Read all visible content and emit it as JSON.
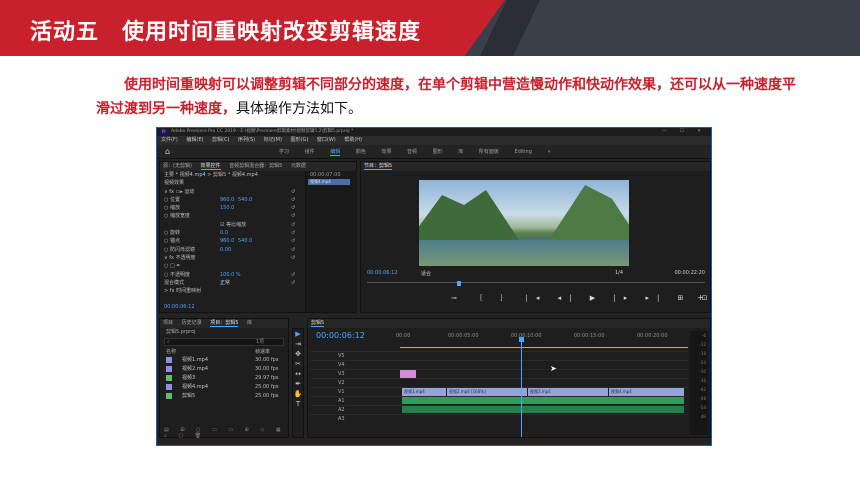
{
  "banner": {
    "title": "活动五　使用时间重映射改变剪辑速度"
  },
  "intro": {
    "red": "使用时间重映射可以调整剪辑不同部分的速度，在单个剪辑中营造慢动作和快动作效果，还可以从一种速度平滑过渡到另一种速度，",
    "black": "具体操作方法如下。"
  },
  "app": {
    "title": "Adobe Premiere Pro CC 2019 - E:\\视频\\Premiere剪辑素材\\视频剪辑5.2\\剪辑5.prproj *",
    "logo": "Pr",
    "window_buttons": "— ☐ ✕",
    "menu": [
      "文件(F)",
      "编辑(E)",
      "剪辑(C)",
      "序列(S)",
      "标记(M)",
      "图形(G)",
      "窗口(W)",
      "帮助(H)"
    ],
    "workspaces": [
      "学习",
      "组件",
      "编辑",
      "颜色",
      "效果",
      "音频",
      "图形",
      "库",
      "所有面板",
      "Editing"
    ],
    "active_workspace": "编辑"
  },
  "effect_controls": {
    "tabs": [
      "源：(无剪辑)",
      "效果控件",
      "音频剪辑混合器：剪辑5",
      "元数据"
    ],
    "clip_path": "主要 * 视频4.mp4  >  剪辑5 * 视频4.mp4",
    "rows": [
      {
        "label": "视频效果",
        "v": "",
        "v2": ""
      },
      {
        "label": "∨ fx ▭▸ 运动",
        "v": "",
        "v2": ""
      },
      {
        "label": "  ○ 位置",
        "v": "960.0",
        "v2": "540.0"
      },
      {
        "label": "  ○ 缩放",
        "v": "150.0",
        "v2": ""
      },
      {
        "label": "  ○ 缩放宽度",
        "v": "",
        "v2": ""
      },
      {
        "label": "",
        "v": "☑ 等比缩放",
        "v2": ""
      },
      {
        "label": "  ○ 旋转",
        "v": "0.0",
        "v2": ""
      },
      {
        "label": "  ○ 锚点",
        "v": "960.0",
        "v2": "540.0"
      },
      {
        "label": "  ○ 防闪烁滤镜",
        "v": "0.00",
        "v2": ""
      },
      {
        "label": "∨ fx 不透明度",
        "v": "",
        "v2": ""
      },
      {
        "label": "  ○ □ ✒",
        "v": "",
        "v2": ""
      },
      {
        "label": "  ○ 不透明度",
        "v": "100.0 %",
        "v2": ""
      },
      {
        "label": "    混合模式",
        "v": "正常",
        "v2": ""
      },
      {
        "label": "> fx 时间重映射",
        "v": "",
        "v2": ""
      }
    ],
    "timecode": "00:00:06:12",
    "tl_time": "00:00:07:00",
    "clip_name": "视频4.mp4"
  },
  "program_monitor": {
    "tab": "节目：剪辑5",
    "timecode": "00:00:06:12",
    "fit": "适合",
    "ratio": "1/4",
    "duration": "00:00:22:20",
    "controls": "⊸ ｛ ｝ |◂ ◂| ▶ |▸ ▸| ⊞ ⊡ ◫ ⊕",
    "plus": "+"
  },
  "project": {
    "tabs": [
      "项目",
      "历史记录",
      "项目：剪辑5",
      "库"
    ],
    "name": "剪辑5.prproj",
    "search_placeholder": "⌕",
    "count": "1项",
    "col_name": "名称",
    "col_rate": "帧速率",
    "items": [
      {
        "name": "视频1.mp4",
        "rate": "30.00 fps"
      },
      {
        "name": "视频2.mp4",
        "rate": "30.00 fps"
      },
      {
        "name": "视频3",
        "rate": "29.97 fps"
      },
      {
        "name": "视频4.mp4",
        "rate": "25.00 fps"
      },
      {
        "name": "剪辑5",
        "rate": "25.00 fps"
      }
    ],
    "bottombar": "▤ ⊞ ○ ▭ ▭ ⊕ ◇ ▦ ⌕ ▢ 🗑"
  },
  "tools": [
    "▶",
    "⇥",
    "✥",
    "✂",
    "↔",
    "✒",
    "✋",
    "T"
  ],
  "timeline": {
    "tab": "剪辑5",
    "timecode": "00:00:06:12",
    "ruler": [
      "00:00",
      "00:00:05:00",
      "00:00:10:00",
      "00:00:15:00",
      "00:00:20:00",
      "00:00:25:00"
    ],
    "tracks": [
      "V5",
      "V4",
      "V3",
      "V2",
      "V1",
      "A1",
      "A2",
      "A3"
    ],
    "clips": [
      "视频1.mp4",
      "视频2.mp4 [160%]",
      "视频3.mp4",
      "视频4.mp4"
    ],
    "meter": [
      "-6",
      "-12",
      "-18",
      "-24",
      "-30",
      "-36",
      "-42",
      "-48",
      "-54",
      "dB"
    ]
  }
}
